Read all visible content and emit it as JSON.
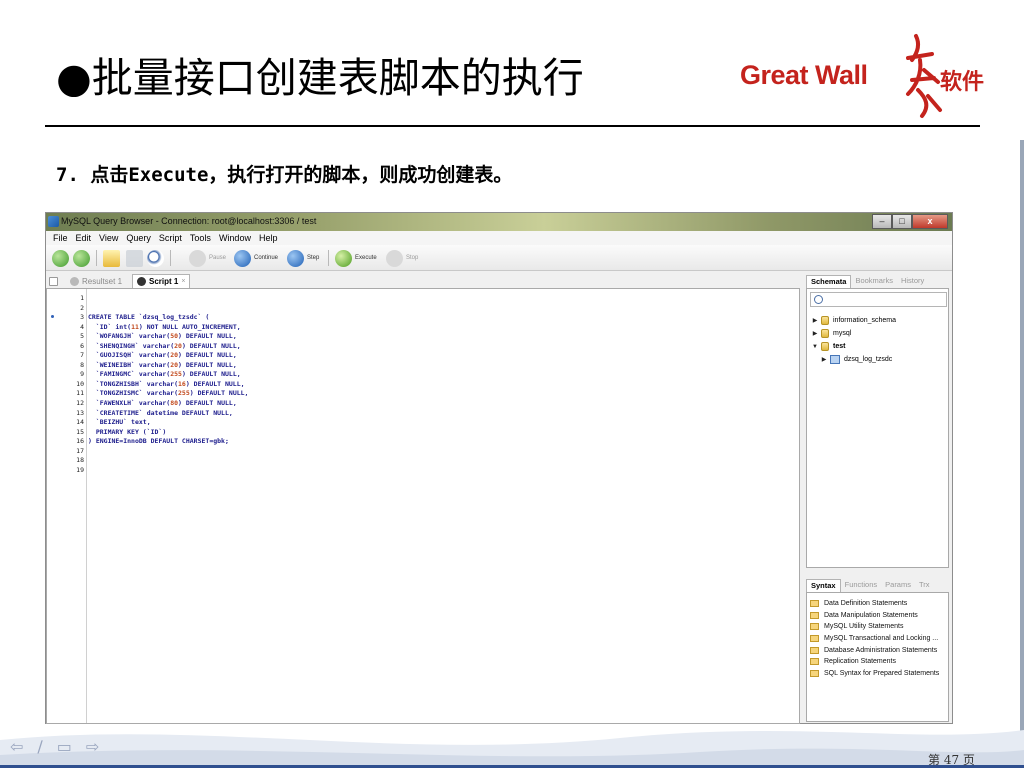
{
  "slide": {
    "title": "●批量接口创建表脚本的执行",
    "step": "7.  点击Execute，执行打开的脚本，则成功创建表。",
    "logo_text": "Great Wall",
    "logo_cn": "软件",
    "page": "第 47 页"
  },
  "window": {
    "title": "MySQL Query Browser - Connection: root@localhost:3306 / test",
    "buttons": {
      "minimize": "–",
      "maximize": "□",
      "close": "x"
    }
  },
  "menu": [
    "File",
    "Edit",
    "View",
    "Query",
    "Script",
    "Tools",
    "Window",
    "Help"
  ],
  "toolbar": {
    "pause": "Pause",
    "continue": "Continue",
    "step": "Step",
    "execute": "Execute",
    "stop": "Stop"
  },
  "tabs": {
    "resultset": "Resultset 1",
    "script": "Script 1"
  },
  "editor": {
    "line_numbers": [
      "1",
      "2",
      "3",
      "4",
      "5",
      "6",
      "7",
      "8",
      "9",
      "10",
      "11",
      "12",
      "13",
      "14",
      "15",
      "16",
      "17",
      "18",
      "19"
    ],
    "lines": [
      "",
      "",
      "CREATE TABLE `dzsq_log_tzsdc` (",
      "  `ID` int(11) NOT NULL AUTO_INCREMENT,",
      "  `WOFANGJH` varchar(50) DEFAULT NULL,",
      "  `SHENQINGH` varchar(20) DEFAULT NULL,",
      "  `GUOJISQH` varchar(20) DEFAULT NULL,",
      "  `WEINEIBH` varchar(20) DEFAULT NULL,",
      "  `FAMINGMC` varchar(255) DEFAULT NULL,",
      "  `TONGZHISBH` varchar(16) DEFAULT NULL,",
      "  `TONGZHISMC` varchar(255) DEFAULT NULL,",
      "  `FAWENXLH` varchar(80) DEFAULT NULL,",
      "  `CREATETIME` datetime DEFAULT NULL,",
      "  `BEIZHU` text,",
      "  PRIMARY KEY (`ID`)",
      ") ENGINE=InnoDB DEFAULT CHARSET=gbk;",
      "",
      "",
      ""
    ]
  },
  "schemata_panel": {
    "tabs": [
      "Schemata",
      "Bookmarks",
      "History"
    ],
    "tree": [
      {
        "label": "information_schema",
        "arrow": "▶",
        "type": "db"
      },
      {
        "label": "mysql",
        "arrow": "▶",
        "type": "db"
      },
      {
        "label": "test",
        "arrow": "▼",
        "type": "db"
      },
      {
        "label": "dzsq_log_tzsdc",
        "arrow": "▶",
        "type": "table"
      }
    ]
  },
  "syntax_panel": {
    "tabs": [
      "Syntax",
      "Functions",
      "Params",
      "Trx"
    ],
    "items": [
      "Data Definition Statements",
      "Data Manipulation Statements",
      "MySQL Utility Statements",
      "MySQL Transactional and Locking ...",
      "Database Administration Statements",
      "Replication Statements",
      "SQL Syntax for Prepared Statements"
    ]
  },
  "colors": {
    "logo_red": "#c4231d",
    "code_blue": "#1c1c8c",
    "code_number": "#c24a1d"
  }
}
